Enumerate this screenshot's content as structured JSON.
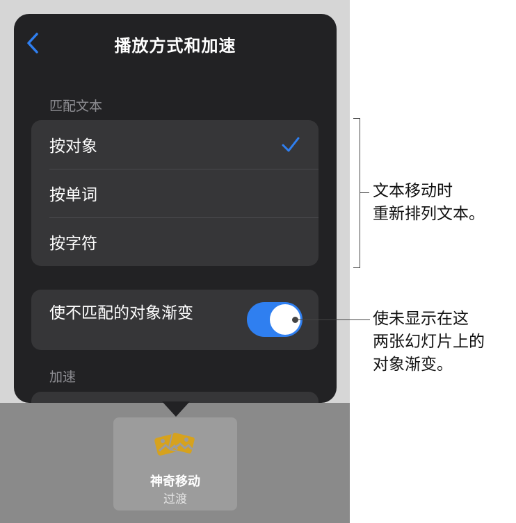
{
  "popover": {
    "title": "播放方式和加速",
    "back_icon": "chevron-left-icon",
    "accent_color": "#2f7ff0",
    "match_text": {
      "label": "匹配文本",
      "options": [
        {
          "label": "按对象",
          "selected": true
        },
        {
          "label": "按单词",
          "selected": false
        },
        {
          "label": "按字符",
          "selected": false
        }
      ]
    },
    "fade_toggle": {
      "label": "使不匹配的对象渐变",
      "on": true
    },
    "acceleration": {
      "label": "加速"
    }
  },
  "transition_tile": {
    "icon": "magic-move-icon",
    "name": "神奇移动",
    "subtitle": "过渡"
  },
  "callouts": {
    "match_text": "文本移动时\n重新排列文本。",
    "fade": "使未显示在这\n两张幻灯片上的\n对象渐变。"
  }
}
